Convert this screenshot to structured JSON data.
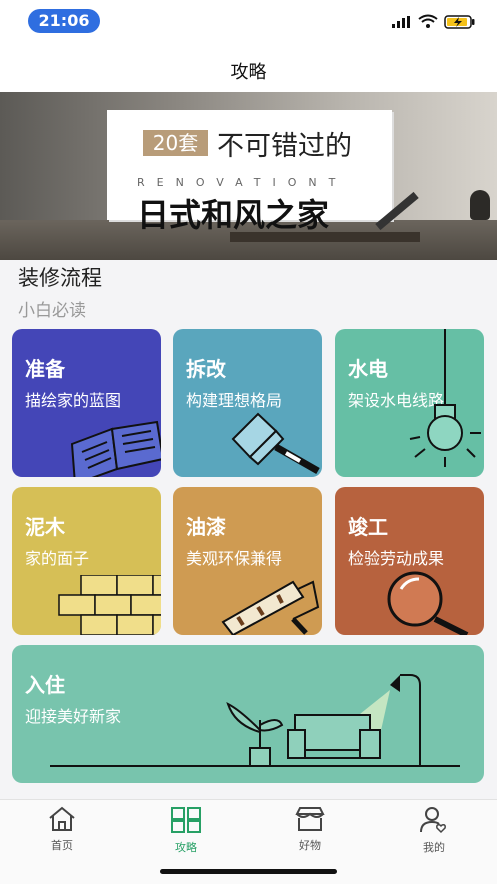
{
  "status_bar": {
    "time": "21:06"
  },
  "nav": {
    "title": "攻略"
  },
  "banner": {
    "tag": "20套",
    "headline": "不可错过的",
    "subtitle": "RENOVATIONT",
    "main": "日式和风之家"
  },
  "section": {
    "title": "装修流程",
    "subtitle": "小白必读"
  },
  "tiles": [
    {
      "title": "准备",
      "desc": "描绘家的蓝图",
      "color": "#4446b7"
    },
    {
      "title": "拆改",
      "desc": "构建理想格局",
      "color": "#5aa6bd"
    },
    {
      "title": "水电",
      "desc": "架设水电线路",
      "color": "#66bfa5"
    },
    {
      "title": "泥木",
      "desc": "家的面子",
      "color": "#d6bf56"
    },
    {
      "title": "油漆",
      "desc": "美观环保兼得",
      "color": "#cf9b52"
    },
    {
      "title": "竣工",
      "desc": "检验劳动成果",
      "color": "#b7623e"
    },
    {
      "title": "入住",
      "desc": "迎接美好新家",
      "color": "#78c4ad"
    }
  ],
  "tabbar": {
    "items": [
      {
        "label": "首页",
        "icon": "home-icon"
      },
      {
        "label": "攻略",
        "icon": "grid-icon",
        "active": true
      },
      {
        "label": "好物",
        "icon": "store-icon"
      },
      {
        "label": "我的",
        "icon": "profile-icon"
      }
    ],
    "active_color": "#27a065"
  }
}
